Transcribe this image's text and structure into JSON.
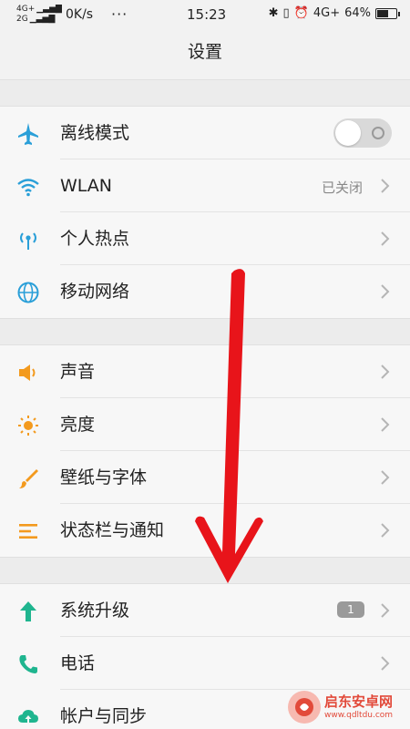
{
  "status_bar": {
    "network_top": "4G+",
    "network_bottom": "2G",
    "speed": "0K/s",
    "dots": "···",
    "time": "15:23",
    "network_right": "4G+",
    "battery": "64%",
    "battery_level": 0.64
  },
  "header": {
    "title": "设置"
  },
  "sections": [
    [
      {
        "label": "离线模式",
        "icon": "airplane-icon",
        "control": "toggle",
        "toggle_on": false
      },
      {
        "label": "WLAN",
        "icon": "wifi-icon",
        "value": "已关闭"
      },
      {
        "label": "个人热点",
        "icon": "hotspot-icon"
      },
      {
        "label": "移动网络",
        "icon": "globe-icon"
      }
    ],
    [
      {
        "label": "声音",
        "icon": "speaker-icon"
      },
      {
        "label": "亮度",
        "icon": "sun-icon"
      },
      {
        "label": "壁纸与字体",
        "icon": "brush-icon"
      },
      {
        "label": "状态栏与通知",
        "icon": "notification-bars-icon"
      }
    ],
    [
      {
        "label": "系统升级",
        "icon": "upgrade-arrow-icon",
        "badge": "1"
      },
      {
        "label": "电话",
        "icon": "phone-icon"
      },
      {
        "label": "帐户与同步",
        "icon": "cloud-sync-icon"
      }
    ]
  ],
  "watermark": {
    "title": "启东安卓网",
    "url": "www.qdltdu.com"
  },
  "colors": {
    "blue_icon": "#2a9fd8",
    "orange_icon": "#f39a1e",
    "green_icon": "#1fb58f",
    "annotation_arrow": "#e8141a"
  }
}
